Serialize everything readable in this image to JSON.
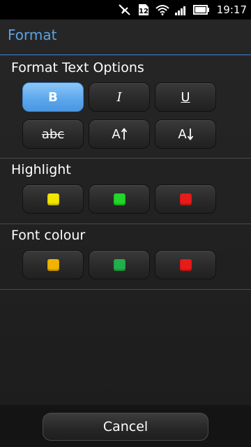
{
  "status_bar": {
    "time": "19:17",
    "icons": [
      "mute-icon",
      "sim-icon",
      "wifi-icon",
      "signal-icon",
      "battery-icon"
    ],
    "sim_label": "12"
  },
  "dialog": {
    "title": "Format",
    "accent_color": "#5aa2e6",
    "sections": {
      "format_text": {
        "label": "Format Text Options",
        "buttons": {
          "bold": "B",
          "italic": "I",
          "underline": "U",
          "strikethrough": "abc",
          "increase_size": "A",
          "decrease_size": "A"
        },
        "selected": "bold"
      },
      "highlight": {
        "label": "Highlight",
        "colors": [
          "#f2e600",
          "#22d62a",
          "#e81b1b"
        ]
      },
      "font_colour": {
        "label": "Font colour",
        "colors": [
          "#f0b400",
          "#21b04b",
          "#e81b1b"
        ]
      }
    }
  },
  "footer": {
    "cancel_label": "Cancel"
  }
}
